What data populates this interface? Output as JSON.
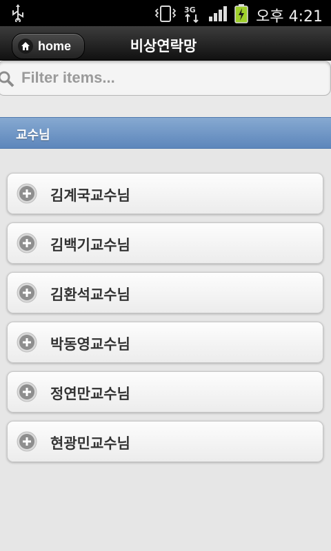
{
  "status_bar": {
    "time": "오후 4:21",
    "network_label": "3G"
  },
  "header": {
    "home_label": "home",
    "title": "비상연락망"
  },
  "filter": {
    "placeholder": "Filter items..."
  },
  "divider": {
    "label": "교수님"
  },
  "list": {
    "items": [
      {
        "label": "김계국교수님"
      },
      {
        "label": "김백기교수님"
      },
      {
        "label": "김환석교수님"
      },
      {
        "label": "박동영교수님"
      },
      {
        "label": "정연만교수님"
      },
      {
        "label": "현광민교수님"
      }
    ]
  },
  "colors": {
    "divider_top": "#86a9d1",
    "divider_bottom": "#5d86bb",
    "battery": "#9ecf2b"
  }
}
